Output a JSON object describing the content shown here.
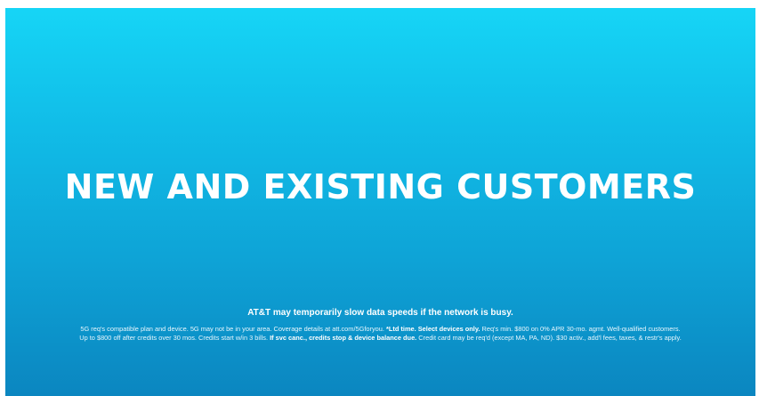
{
  "ad": {
    "headline": "NEW AND EXISTING CUSTOMERS",
    "network_notice": "AT&T may temporarily slow data speeds if the network is busy.",
    "disclaimer": {
      "part1": "5G req's compatible plan and device. 5G may not be in your area. Coverage details at att.com/5Gforyou. ",
      "bold1": "*Ltd time. Select devices only.",
      "part2": " Req's min. $800 on 0% APR 30-mo. agmt. Well-qualified customers. Up to $800 off after credits over 30 mos. Credits start w/in 3 bills. ",
      "bold2": "If svc canc., credits stop & device balance due.",
      "part3": " Credit card may be req'd (except MA, PA, ND). $30 activ., add'l fees, taxes, & restr's apply."
    }
  },
  "colors": {
    "background_top": "#16d5f6",
    "background_bottom": "#0b86c0",
    "text": "#ffffff"
  }
}
